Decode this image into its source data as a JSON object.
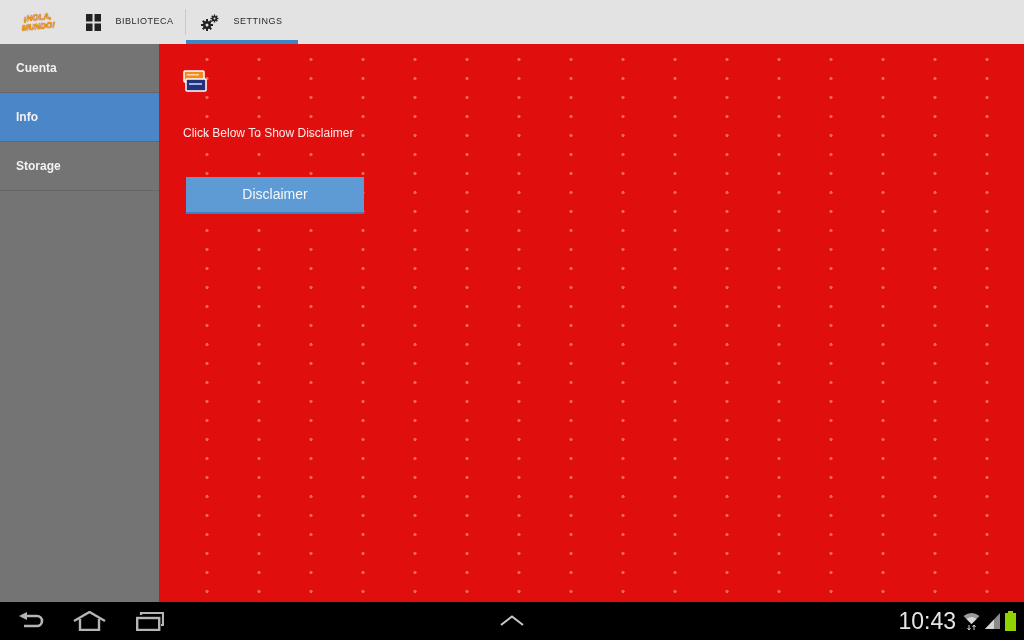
{
  "action_bar": {
    "logo": "¡HOLA, MUNDO!",
    "tabs": [
      {
        "label": "BIBLIOTECA",
        "kind": "library",
        "selected": false
      },
      {
        "label": "SETTINGS",
        "kind": "settings",
        "selected": true
      }
    ]
  },
  "sidebar": {
    "items": [
      {
        "label": "Cuenta",
        "selected": false
      },
      {
        "label": "Info",
        "selected": true
      },
      {
        "label": "Storage",
        "selected": false
      }
    ]
  },
  "content": {
    "prompt": "Click Below To Show Disclaimer",
    "button": "Disclaimer"
  },
  "nav_bar": {
    "time": "10:43"
  }
}
